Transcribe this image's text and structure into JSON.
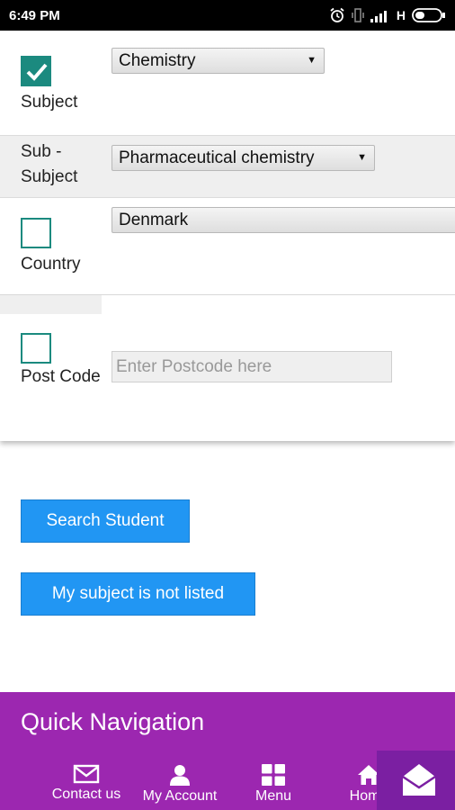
{
  "status_bar": {
    "time": "6:49 PM",
    "network": "H",
    "icons": [
      "alarm-icon",
      "vibrate-icon",
      "signal-icon",
      "battery-icon"
    ]
  },
  "form": {
    "subject": {
      "label": "Subject",
      "checked": true,
      "selected": "Chemistry"
    },
    "sub_subject": {
      "label": "Sub - Subject",
      "selected": "Pharmaceutical chemistry"
    },
    "country": {
      "label": "Country",
      "checked": false,
      "selected": "Denmark"
    },
    "postcode": {
      "label": "Post Code",
      "checked": false,
      "value": "",
      "placeholder": "Enter Postcode here"
    }
  },
  "buttons": {
    "search_student": "Search Student",
    "not_listed": "My subject is not listed"
  },
  "quick_navigation": {
    "title": "Quick Navigation",
    "items": [
      {
        "label": "Contact us",
        "icon": "mail-icon"
      },
      {
        "label": "My Account",
        "icon": "person-icon"
      },
      {
        "label": "Menu",
        "icon": "grid-icon"
      },
      {
        "label": "Home",
        "icon": "home-icon"
      }
    ]
  },
  "colors": {
    "accent_teal": "#1b8a7f",
    "button_blue": "#2196f3",
    "nav_purple": "#9c27b0",
    "fab_purple": "#7b1fa2"
  }
}
